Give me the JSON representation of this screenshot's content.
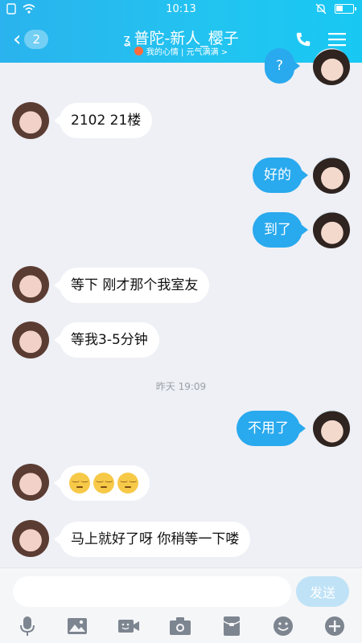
{
  "status": {
    "time": "10:13"
  },
  "header": {
    "back_badge": "2",
    "title": "普陀-新人_樱子",
    "subtitle": "我的心情 | 元气满满 >"
  },
  "messages": [
    {
      "side": "right",
      "text": "?"
    },
    {
      "side": "left",
      "text": "2102  21楼"
    },
    {
      "side": "right",
      "text": "好的"
    },
    {
      "side": "right",
      "text": "到了"
    },
    {
      "side": "left",
      "text": "等下  刚才那个我室友"
    },
    {
      "side": "left",
      "text": "等我3-5分钟"
    },
    {
      "side": "right",
      "text": "不用了"
    },
    {
      "side": "left",
      "emoji": [
        "pensive-face",
        "pensive-face",
        "pensive-face"
      ]
    },
    {
      "side": "left",
      "text": "马上就好了呀 你稍等一下喽"
    }
  ],
  "timestamp": "昨天 19:09",
  "composer": {
    "placeholder": "",
    "send_label": "发送"
  },
  "toolbar": {
    "icons": [
      "microphone-icon",
      "image-icon",
      "video-call-icon",
      "camera-icon",
      "red-packet-icon",
      "emoji-icon",
      "plus-icon"
    ]
  },
  "colors": {
    "accent": "#29a9ee",
    "header": "#22c4f0",
    "background": "#eef0f5"
  }
}
